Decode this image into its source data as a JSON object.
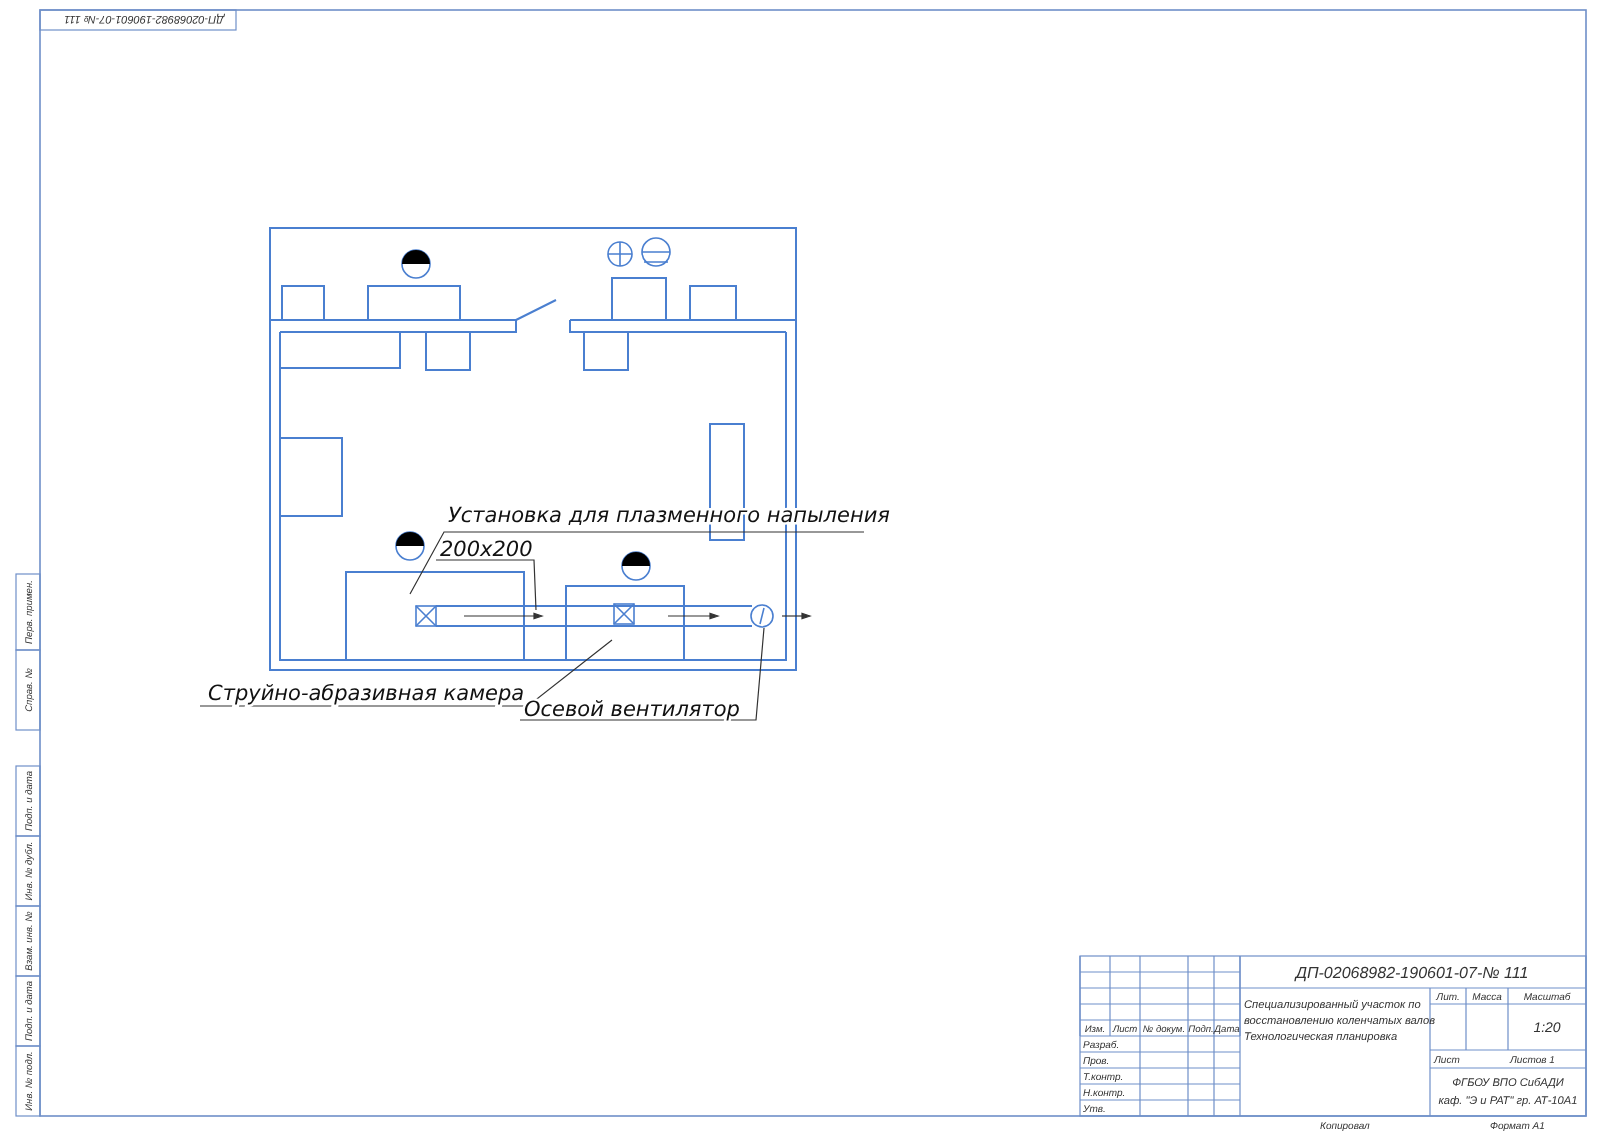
{
  "stamp": "ДП-02068982-190601-07-№ 111",
  "plan": {
    "label_plasma": "Установка для плазменного напыления",
    "label_size": "200x200",
    "label_camera": "Струйно-абразивная камера",
    "label_fan": "Осевой вентилятор"
  },
  "side_strip": [
    "Перв. примен.",
    "Справ. №",
    "Подп. и дата",
    "Инв. № дубл.",
    "Взам. инв. №",
    "Подп. и дата",
    "Инв. № подл."
  ],
  "title_block": {
    "designation": "ДП-02068982-190601-07-№ 111",
    "name_lines": [
      "Специализированный участок по",
      "восстановлению коленчатых валов",
      "Технологическая планировка"
    ],
    "header_cells": [
      "Изм.",
      "Лист",
      "№ докум.",
      "Подп.",
      "Дата"
    ],
    "roles": [
      "Разраб.",
      "Пров.",
      "Т.контр.",
      "Н.контр.",
      "Утв."
    ],
    "stage_headers": [
      "Лит.",
      "Масса",
      "Масштаб"
    ],
    "scale": "1:20",
    "sheet": "Лист",
    "sheets": "Листов 1",
    "organization": [
      "ФГБОУ ВПО СибАДИ",
      "каф. \"Э и РАТ\" гр. АТ-10А1"
    ],
    "copied": "Копировал",
    "format": "Формат A1"
  }
}
